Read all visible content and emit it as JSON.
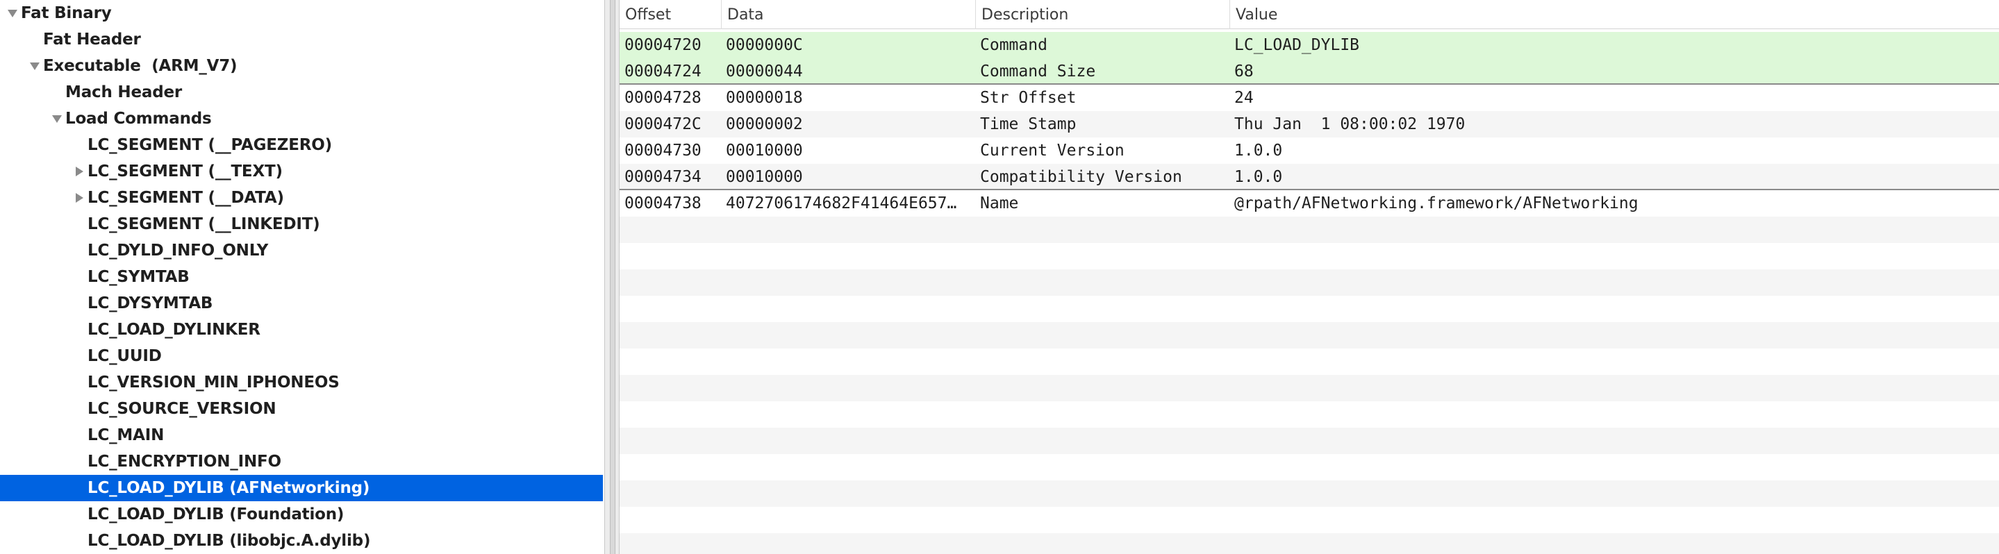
{
  "tree": {
    "items": [
      {
        "label": "Fat Binary",
        "indent": 0,
        "disclosure": "expanded",
        "selected": false
      },
      {
        "label": "Fat Header",
        "indent": 1,
        "disclosure": "none",
        "selected": false
      },
      {
        "label": "Executable  (ARM_V7)",
        "indent": 1,
        "disclosure": "expanded",
        "selected": false
      },
      {
        "label": "Mach Header",
        "indent": 2,
        "disclosure": "none",
        "selected": false
      },
      {
        "label": "Load Commands",
        "indent": 2,
        "disclosure": "expanded",
        "selected": false
      },
      {
        "label": "LC_SEGMENT (__PAGEZERO)",
        "indent": 3,
        "disclosure": "none",
        "selected": false
      },
      {
        "label": "LC_SEGMENT (__TEXT)",
        "indent": 3,
        "disclosure": "collapsed",
        "selected": false
      },
      {
        "label": "LC_SEGMENT (__DATA)",
        "indent": 3,
        "disclosure": "collapsed",
        "selected": false
      },
      {
        "label": "LC_SEGMENT (__LINKEDIT)",
        "indent": 3,
        "disclosure": "none",
        "selected": false
      },
      {
        "label": "LC_DYLD_INFO_ONLY",
        "indent": 3,
        "disclosure": "none",
        "selected": false
      },
      {
        "label": "LC_SYMTAB",
        "indent": 3,
        "disclosure": "none",
        "selected": false
      },
      {
        "label": "LC_DYSYMTAB",
        "indent": 3,
        "disclosure": "none",
        "selected": false
      },
      {
        "label": "LC_LOAD_DYLINKER",
        "indent": 3,
        "disclosure": "none",
        "selected": false
      },
      {
        "label": "LC_UUID",
        "indent": 3,
        "disclosure": "none",
        "selected": false
      },
      {
        "label": "LC_VERSION_MIN_IPHONEOS",
        "indent": 3,
        "disclosure": "none",
        "selected": false
      },
      {
        "label": "LC_SOURCE_VERSION",
        "indent": 3,
        "disclosure": "none",
        "selected": false
      },
      {
        "label": "LC_MAIN",
        "indent": 3,
        "disclosure": "none",
        "selected": false
      },
      {
        "label": "LC_ENCRYPTION_INFO",
        "indent": 3,
        "disclosure": "none",
        "selected": false
      },
      {
        "label": "LC_LOAD_DYLIB (AFNetworking)",
        "indent": 3,
        "disclosure": "none",
        "selected": true
      },
      {
        "label": "LC_LOAD_DYLIB (Foundation)",
        "indent": 3,
        "disclosure": "none",
        "selected": false
      },
      {
        "label": "LC_LOAD_DYLIB (libobjc.A.dylib)",
        "indent": 3,
        "disclosure": "none",
        "selected": false
      }
    ]
  },
  "table": {
    "columns": [
      "Offset",
      "Data",
      "Description",
      "Value"
    ],
    "rows": [
      {
        "offset": "00004720",
        "data": "0000000C",
        "description": "Command",
        "value": "LC_LOAD_DYLIB",
        "highlight": true
      },
      {
        "offset": "00004724",
        "data": "00000044",
        "description": "Command Size",
        "value": "68",
        "highlight": true
      },
      {
        "offset": "00004728",
        "data": "00000018",
        "description": "Str Offset",
        "value": "24",
        "highlight": false
      },
      {
        "offset": "0000472C",
        "data": "00000002",
        "description": "Time Stamp",
        "value": "Thu Jan  1 08:00:02 1970",
        "highlight": false
      },
      {
        "offset": "00004730",
        "data": "00010000",
        "description": "Current Version",
        "value": "1.0.0",
        "highlight": false
      },
      {
        "offset": "00004734",
        "data": "00010000",
        "description": "Compatibility Version",
        "value": "1.0.0",
        "highlight": false
      },
      {
        "offset": "00004738",
        "data": "4072706174682F41464E657…",
        "description": "Name",
        "value": "@rpath/AFNetworking.framework/AFNetworking",
        "highlight": false
      }
    ],
    "empty_row_count": 13
  },
  "icons": {
    "expanded": "disclosure-triangle-down-icon",
    "collapsed": "disclosure-triangle-right-icon"
  },
  "colors": {
    "selection": "#0063e1",
    "row_highlight": "#ddf8d8",
    "row_alternate": "#f5f5f5"
  }
}
